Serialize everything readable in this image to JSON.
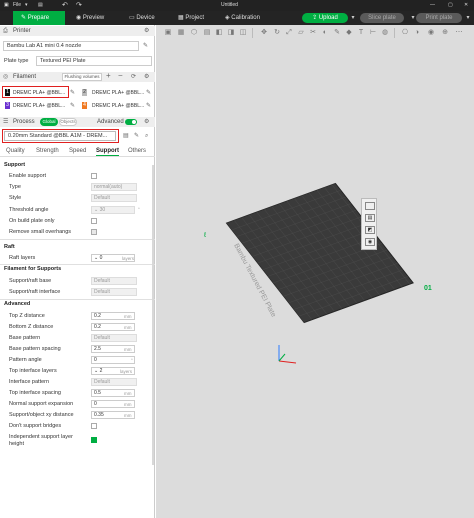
{
  "titlebar": {
    "file_label": "File",
    "dropdown": "▾",
    "undo": "↶",
    "redo": "↷",
    "window_title": "Untitled",
    "minimize": "—",
    "maximize": "▢",
    "close": "✕"
  },
  "nav": {
    "tabs": [
      {
        "label": "Prepare"
      },
      {
        "label": "Preview"
      },
      {
        "label": "Device"
      },
      {
        "label": "Project"
      },
      {
        "label": "Calibration"
      }
    ],
    "upload": "Upload",
    "slice_plate": "Slice plate",
    "print_plate": "Print plate"
  },
  "printer": {
    "section_label": "Printer",
    "printer_name": "Bambu Lab A1 mini 0.4 nozzle",
    "plate_type_label": "Plate type",
    "plate_type_value": "Textured PEI Plate"
  },
  "filament": {
    "section_label": "Filament",
    "flushing_btn": "Flushing volumes",
    "slots": [
      {
        "number": "1",
        "name": "DREMC PLA+ @BBL...",
        "color": "#111111"
      },
      {
        "number": "2",
        "name": "DREMC PLA+ @BBL...",
        "color": "#bbbbbb"
      },
      {
        "number": "3",
        "name": "DREMC PLA+ @BBL...",
        "color": "#6a2fd0"
      },
      {
        "number": "4",
        "name": "DREMC PLA+ @BBL...",
        "color": "#f07a23"
      }
    ]
  },
  "process": {
    "section_label": "Process",
    "toggle_global": "Global",
    "toggle_objects": "Objects",
    "advanced_label": "Advanced",
    "profile": "0.20mm Standard @BBL A1M - DREM...",
    "tabs": [
      "Quality",
      "Strength",
      "Speed",
      "Support",
      "Others"
    ],
    "active_tab": "Support"
  },
  "support": {
    "group_label": "Support",
    "enable_support_label": "Enable support",
    "type_label": "Type",
    "type_value": "normal(auto)",
    "style_label": "Style",
    "style_value": "Default",
    "threshold_label": "Threshold angle",
    "threshold_value": "30",
    "threshold_unit": "°",
    "build_plate_only_label": "On build plate only",
    "remove_small_label": "Remove small overhangs"
  },
  "raft": {
    "group_label": "Raft",
    "layers_label": "Raft layers",
    "layers_value": "0",
    "layers_unit": "layers"
  },
  "filament_for_supports": {
    "group_label": "Filament for Supports",
    "base_label": "Support/raft base",
    "base_value": "Default",
    "interface_label": "Support/raft interface",
    "interface_value": "Default"
  },
  "advanced": {
    "group_label": "Advanced",
    "rows": [
      {
        "label": "Top Z distance",
        "value": "0.2",
        "unit": "mm"
      },
      {
        "label": "Bottom Z distance",
        "value": "0.2",
        "unit": "mm"
      },
      {
        "label": "Base pattern",
        "value": "Default",
        "unit": ""
      },
      {
        "label": "Base pattern spacing",
        "value": "2.5",
        "unit": "mm"
      },
      {
        "label": "Pattern angle",
        "value": "0",
        "unit": "°"
      },
      {
        "label": "Top interface layers",
        "value": "2",
        "unit": "layers"
      },
      {
        "label": "Interface pattern",
        "value": "Default",
        "unit": ""
      },
      {
        "label": "Top interface spacing",
        "value": "0.5",
        "unit": "mm"
      },
      {
        "label": "Normal support expansion",
        "value": "0",
        "unit": "mm"
      },
      {
        "label": "Support/object xy distance",
        "value": "0.35",
        "unit": "mm"
      }
    ],
    "dont_bridge_label": "Don't support bridges",
    "independent_height_label": "Independent support layer height"
  },
  "plate": {
    "plate_text": "Bambu Textured PEI Plate",
    "plate_number": "01"
  },
  "colors": {
    "accent": "#00ae42",
    "highlight_box": "#e02020"
  }
}
